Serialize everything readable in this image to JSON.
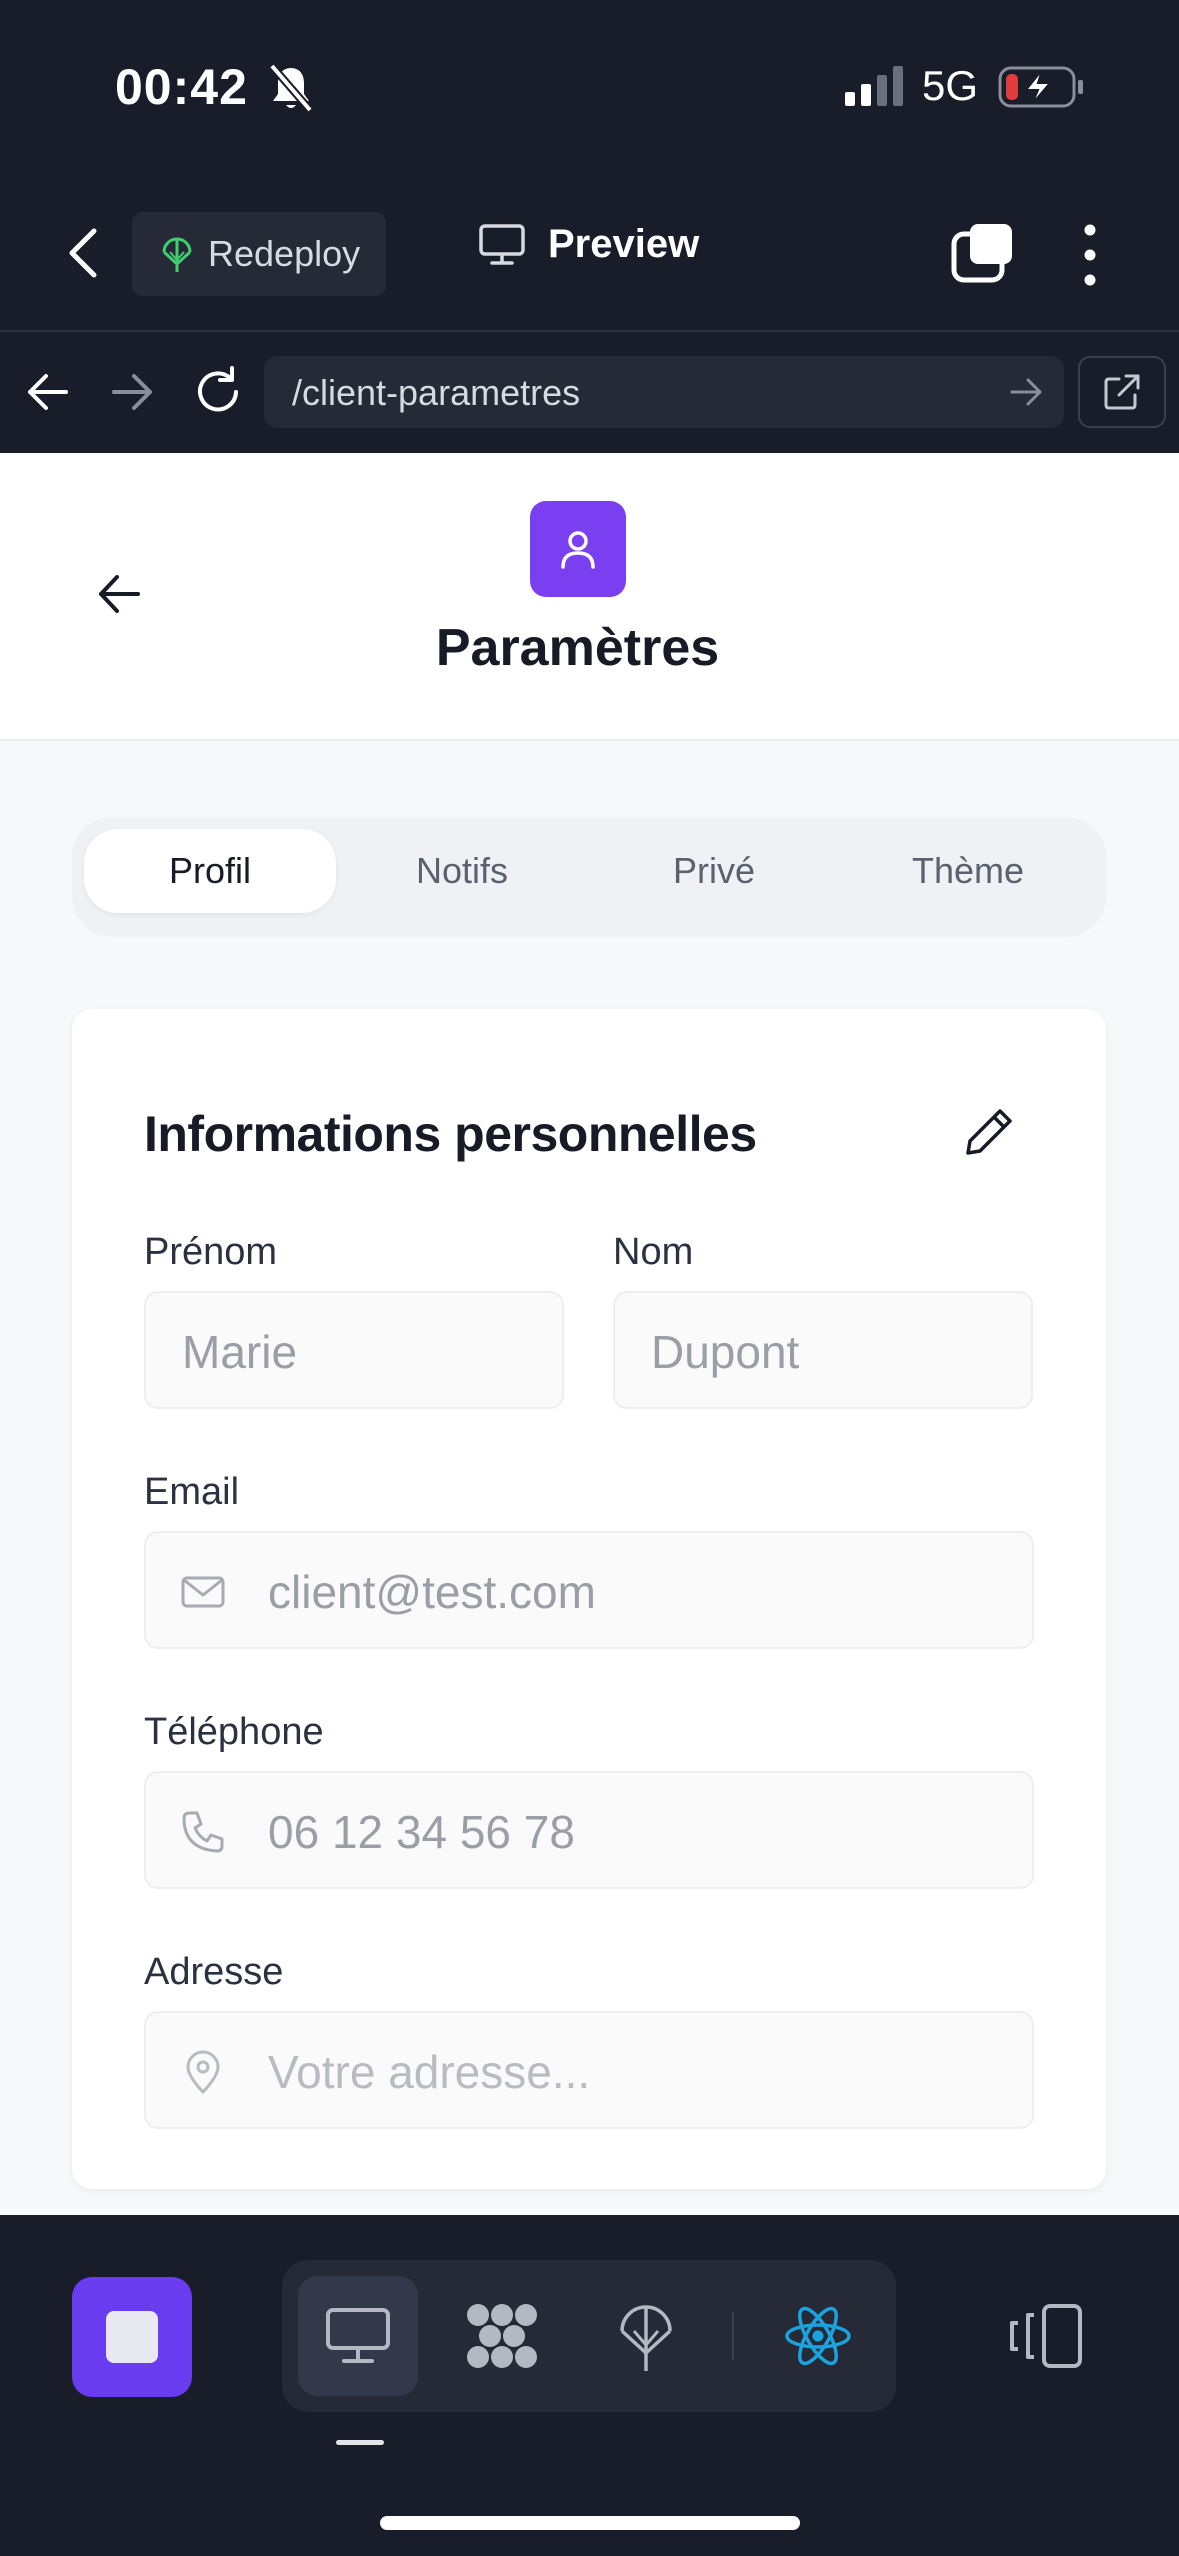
{
  "status_bar": {
    "time": "00:42",
    "network": "5G"
  },
  "app_header": {
    "redeploy_label": "Redeploy",
    "preview_label": "Preview"
  },
  "url_bar": {
    "path": "/client-parametres"
  },
  "page": {
    "title": "Paramètres",
    "tabs": [
      {
        "label": "Profil",
        "active": true
      },
      {
        "label": "Notifs",
        "active": false
      },
      {
        "label": "Privé",
        "active": false
      },
      {
        "label": "Thème",
        "active": false
      }
    ],
    "card": {
      "title": "Informations personnelles",
      "first_name": {
        "label": "Prénom",
        "value": "Marie"
      },
      "last_name": {
        "label": "Nom",
        "value": "Dupont"
      },
      "email": {
        "label": "Email",
        "value": "client@test.com",
        "icon": "mail-icon"
      },
      "phone": {
        "label": "Téléphone",
        "value": "06 12 34 56 78",
        "icon": "phone-icon"
      },
      "address": {
        "label": "Adresse",
        "placeholder": "Votre adresse...",
        "icon": "map-pin-icon"
      }
    }
  },
  "colors": {
    "accent": "#7b3ff2",
    "toolbar_bg": "#191c29",
    "react_blue": "#1ba3e0"
  }
}
